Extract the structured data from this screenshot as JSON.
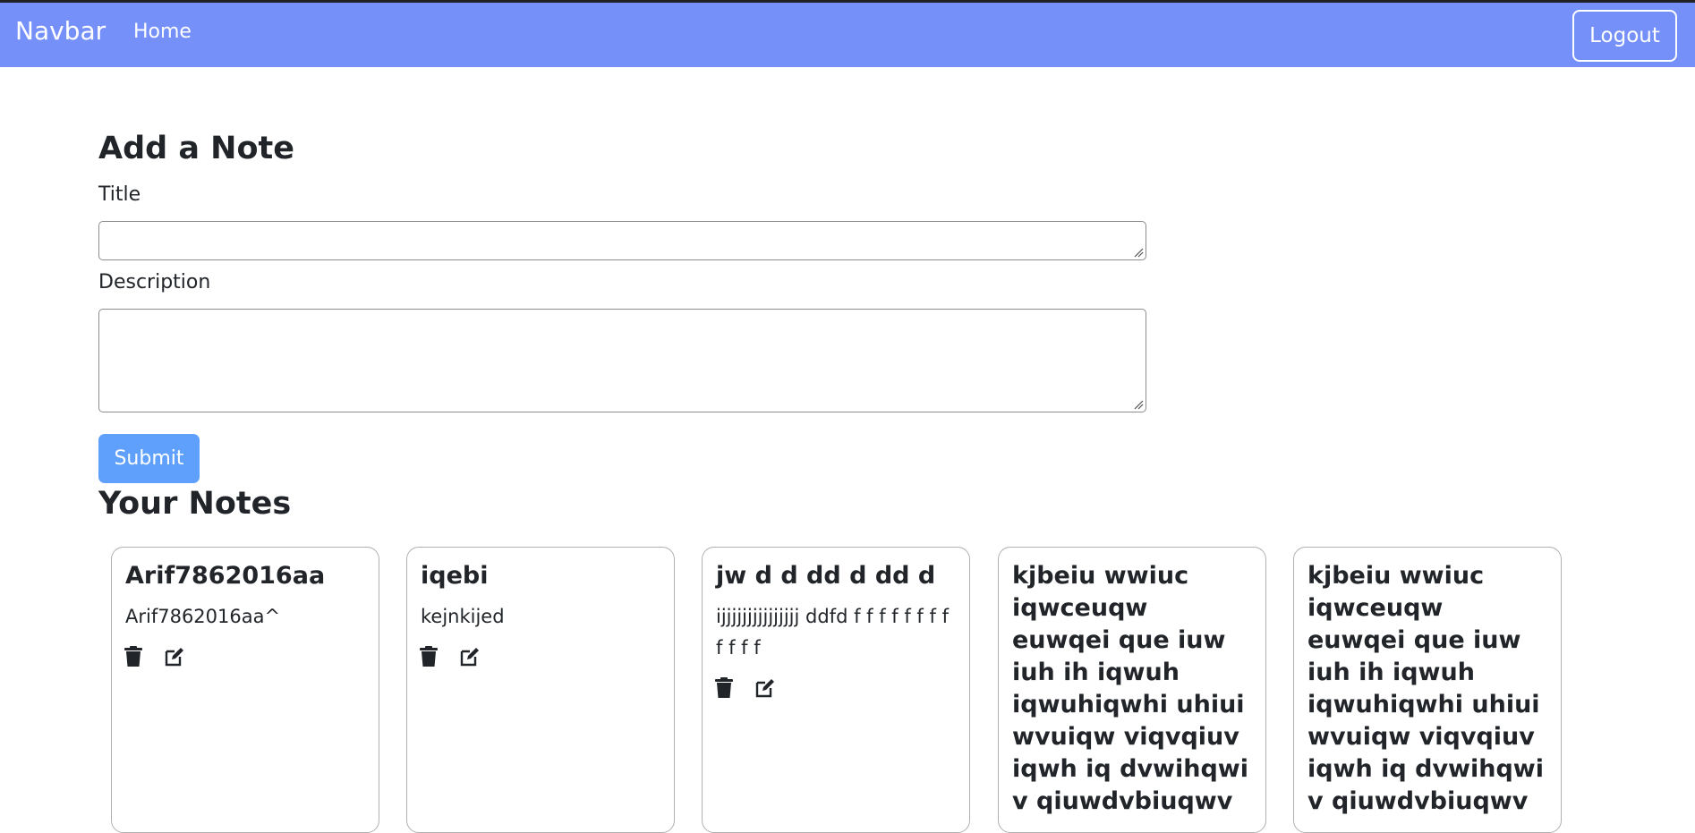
{
  "navbar": {
    "brand": "Navbar",
    "links": [
      "Home"
    ],
    "logout_label": "Logout",
    "color": "#7690f9"
  },
  "add_note": {
    "heading": "Add a Note",
    "title_label": "Title",
    "title_value": "",
    "description_label": "Description",
    "description_value": "",
    "submit_label": "Submit"
  },
  "notes_section": {
    "heading": "Your Notes",
    "notes": [
      {
        "title": "Arif7862016aa",
        "description": "Arif7862016aa^"
      },
      {
        "title": "iqebi",
        "description": "kejnkijed"
      },
      {
        "title": "jw d d dd d dd d",
        "description": "ijjjjjjjjjjjjjjj ddfd f f f f f f f f f f f f"
      },
      {
        "title": "kjbeiu wwiuc iqwceuqw euwqei que iuw iuh ih iqwuh iqwuhiqwhi uhiui wvuiqw viqvqiuv iqwh iq dvwihqwi v qiuwdvbiuqwv",
        "description": ""
      },
      {
        "title": "kjbeiu wwiuc iqwceuqw euwqei que iuw iuh ih iqwuh iqwuhiqwhi uhiui wvuiqw viqvqiuv iqwh iq dvwihqwi v qiuwdvbiuqwv",
        "description": ""
      }
    ],
    "icons": {
      "delete": "trash-icon",
      "edit": "edit-icon"
    }
  }
}
